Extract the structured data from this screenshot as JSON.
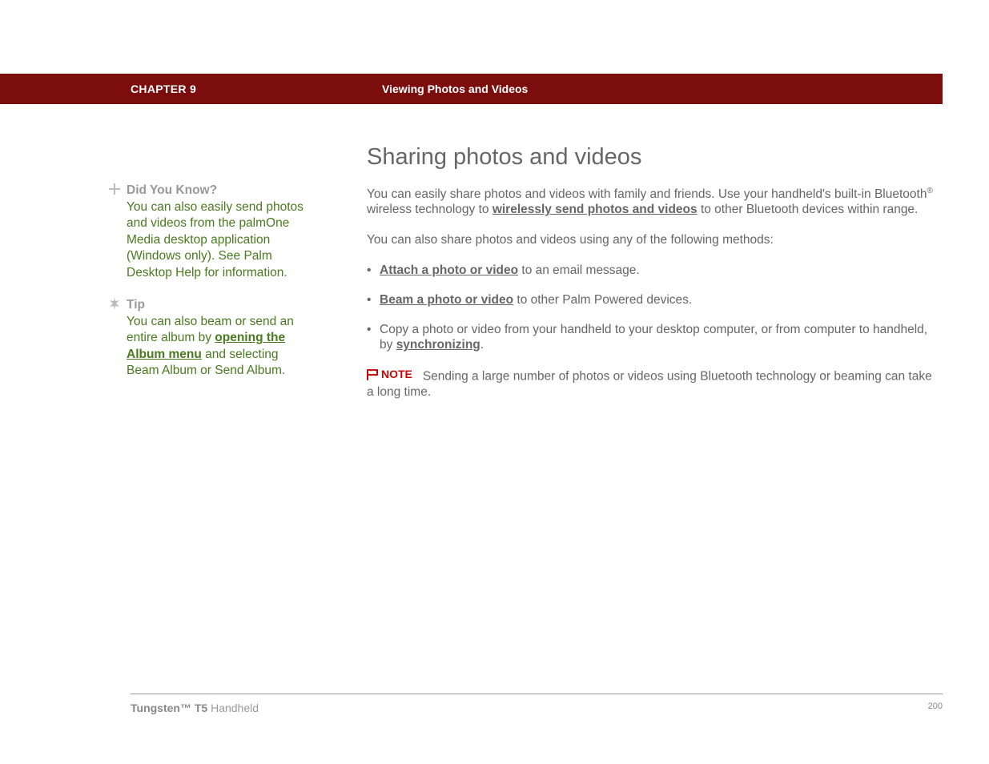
{
  "header": {
    "chapter": "CHAPTER 9",
    "section": "Viewing Photos and Videos"
  },
  "sidebar": {
    "did_you_know": {
      "title": "Did You Know?",
      "body": "You can also easily send photos and videos from the palmOne Media desktop application (Windows only). See Palm Desktop Help for information."
    },
    "tip": {
      "title": "Tip",
      "body_a": "You can also beam or send an entire album by ",
      "link": "opening the Album menu",
      "body_b": " and selecting Beam Album or Send Album."
    }
  },
  "main": {
    "heading": "Sharing photos and videos",
    "p1_a": "You can easily share photos and videos with family and friends. Use your handheld's built-in Bluetooth",
    "p1_sup": "®",
    "p1_b": " wireless technology to ",
    "p1_link": "wirelessly send photos and videos",
    "p1_c": " to other Bluetooth devices within range.",
    "p2": "You can also share photos and videos using any of the following methods:",
    "b1_link": "Attach a photo or video",
    "b1_rest": " to an email message.",
    "b2_link": "Beam a photo or video",
    "b2_rest": " to other Palm Powered devices.",
    "b3_a": "Copy a photo or video from your handheld to your desktop computer, or from computer to handheld, by ",
    "b3_link": "synchronizing",
    "b3_b": ".",
    "note_label": "NOTE",
    "note_body": "Sending a large number of photos or videos using Bluetooth technology or beaming can take a long time."
  },
  "footer": {
    "product_a": "Tungsten™ T5",
    "product_b": " Handheld",
    "page": "200"
  }
}
